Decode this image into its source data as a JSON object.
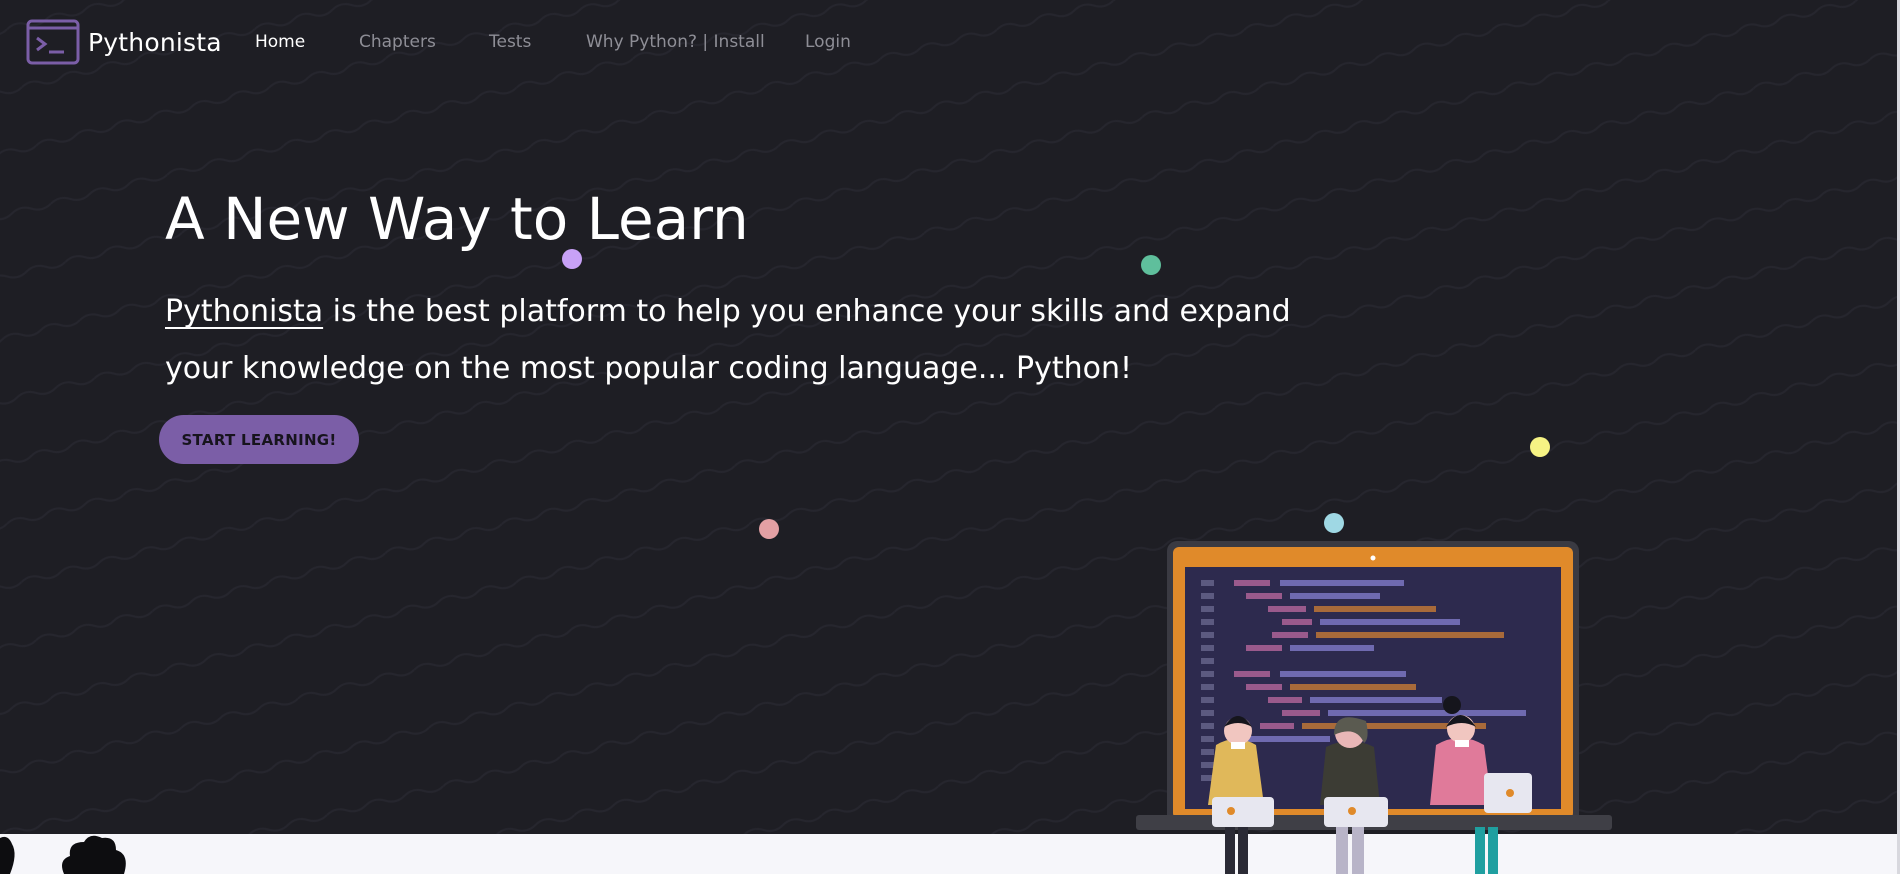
{
  "app": {
    "name": "Pythonista"
  },
  "nav": {
    "items": [
      {
        "label": "Home",
        "active": true
      },
      {
        "label": "Chapters",
        "active": false
      },
      {
        "label": "Tests",
        "active": false
      },
      {
        "label": "Why Python? | Install",
        "active": false
      },
      {
        "label": "Login",
        "active": false
      }
    ]
  },
  "hero": {
    "title": "A New Way to Learn",
    "brand_link": "Pythonista",
    "description_rest": " is the best platform to help you enhance your skills and expand your knowledge on the most popular coding language... Python!",
    "cta_label": "START LEARNING!"
  },
  "colors": {
    "background": "#1e1e24",
    "accent": "#7b5ea7",
    "nav_inactive": "#8e8e96",
    "dot_purple": "#c8a1f7",
    "dot_green": "#5fbf9c",
    "dot_yellow": "#f6f384",
    "dot_blue": "#9fd8e4",
    "dot_pink": "#e3a0a4",
    "laptop_frame": "#e08a2a",
    "laptop_screen": "#2d2a4e"
  },
  "icons": {
    "brand": "terminal-prompt-icon"
  }
}
